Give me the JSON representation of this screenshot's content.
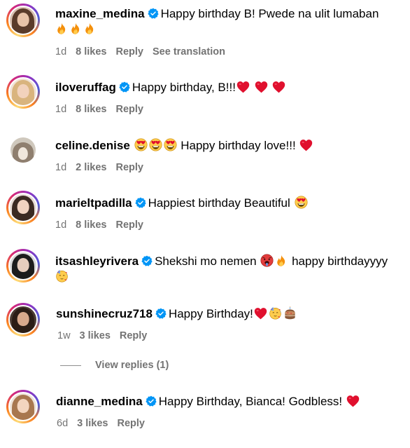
{
  "comments": [
    {
      "username": "maxine_medina",
      "verified": true,
      "text_parts": [
        "Happy birthday B! Pwede na ulit lumaban",
        "",
        ""
      ],
      "time": "1d",
      "likes": "8 likes",
      "reply": "Reply",
      "translate": "See translation"
    },
    {
      "username": "iloveruffag",
      "verified": true,
      "text_parts": [
        "Happy birthday, B!!!"
      ],
      "time": "1d",
      "likes": "8 likes",
      "reply": "Reply"
    },
    {
      "username": "celine.denise",
      "verified": false,
      "text_parts": [
        "Happy birthday love!!!"
      ],
      "time": "1d",
      "likes": "2 likes",
      "reply": "Reply"
    },
    {
      "username": "marieltpadilla",
      "verified": true,
      "text_parts": [
        "Happiest birthday Beautiful"
      ],
      "time": "1d",
      "likes": "8 likes",
      "reply": "Reply"
    },
    {
      "username": "itsashleyrivera",
      "verified": true,
      "text_parts": [
        "Shekshi mo nemen",
        "happy birthdayyyy"
      ],
      "time": "",
      "likes": "",
      "reply": ""
    },
    {
      "username": "sunshinecruz718",
      "verified": true,
      "text_parts": [
        "Happy Birthday!"
      ],
      "time": "1w",
      "likes": "3 likes",
      "reply": "Reply",
      "view_replies": "View replies (1)"
    },
    {
      "username": "dianne_medina",
      "verified": true,
      "text_parts": [
        "Happy Birthday, Bianca! Godbless!"
      ],
      "time": "6d",
      "likes": "3 likes",
      "reply": "Reply"
    }
  ],
  "icons": {
    "verified": "verified-badge-icon",
    "fire": "fire-emoji",
    "heart": "red-heart-emoji",
    "heart_eyes": "heart-eyes-emoji",
    "hot_face": "hot-face-emoji",
    "party": "partying-face-emoji",
    "cake": "birthday-cake-emoji"
  },
  "colors": {
    "meta_text": "#737373",
    "verified_blue": "#0095f6",
    "heart_red": "#e0102e"
  }
}
